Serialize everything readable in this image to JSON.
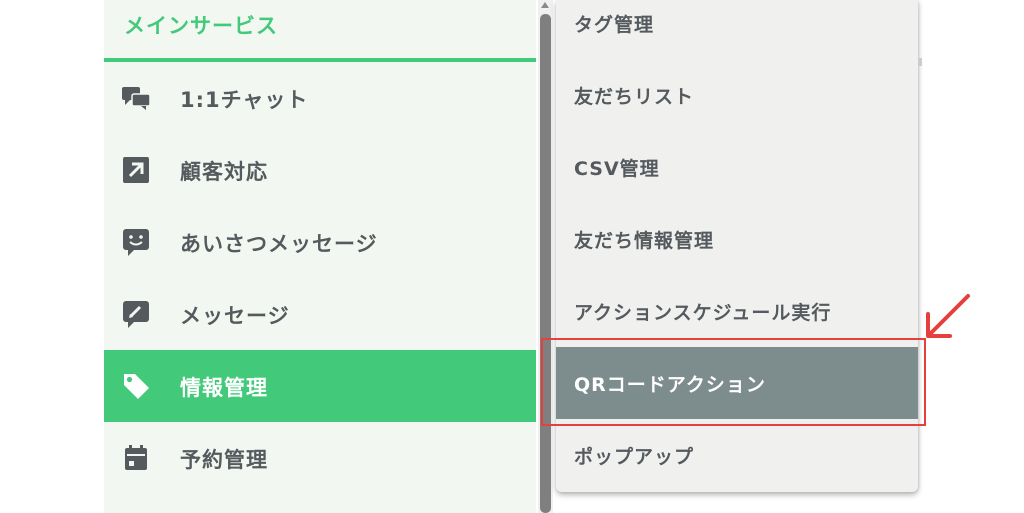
{
  "sidebar": {
    "header": "メインサービス",
    "items": [
      {
        "label": "1:1チャット",
        "icon": "chat-bubbles-icon"
      },
      {
        "label": "顧客対応",
        "icon": "arrow-up-right-icon"
      },
      {
        "label": "あいさつメッセージ",
        "icon": "smile-message-icon"
      },
      {
        "label": "メッセージ",
        "icon": "edit-message-icon"
      },
      {
        "label": "情報管理",
        "icon": "tag-icon",
        "active": true
      },
      {
        "label": "予約管理",
        "icon": "calendar-icon"
      }
    ]
  },
  "submenu": {
    "items": [
      {
        "label": "タグ管理"
      },
      {
        "label": "友だちリスト"
      },
      {
        "label": "CSV管理"
      },
      {
        "label": "友だち情報管理"
      },
      {
        "label": "アクションスケジュール実行"
      },
      {
        "label": "QRコードアクション",
        "active": true,
        "highlighted": true
      },
      {
        "label": "ポップアップ"
      }
    ]
  },
  "colors": {
    "accent_green": "#43c97a",
    "sidebar_bg": "#f2f8f1",
    "submenu_bg": "#f0f0ef",
    "submenu_active": "#7d8c8c",
    "text": "#555a5e",
    "annotation_red": "#e5403c"
  }
}
